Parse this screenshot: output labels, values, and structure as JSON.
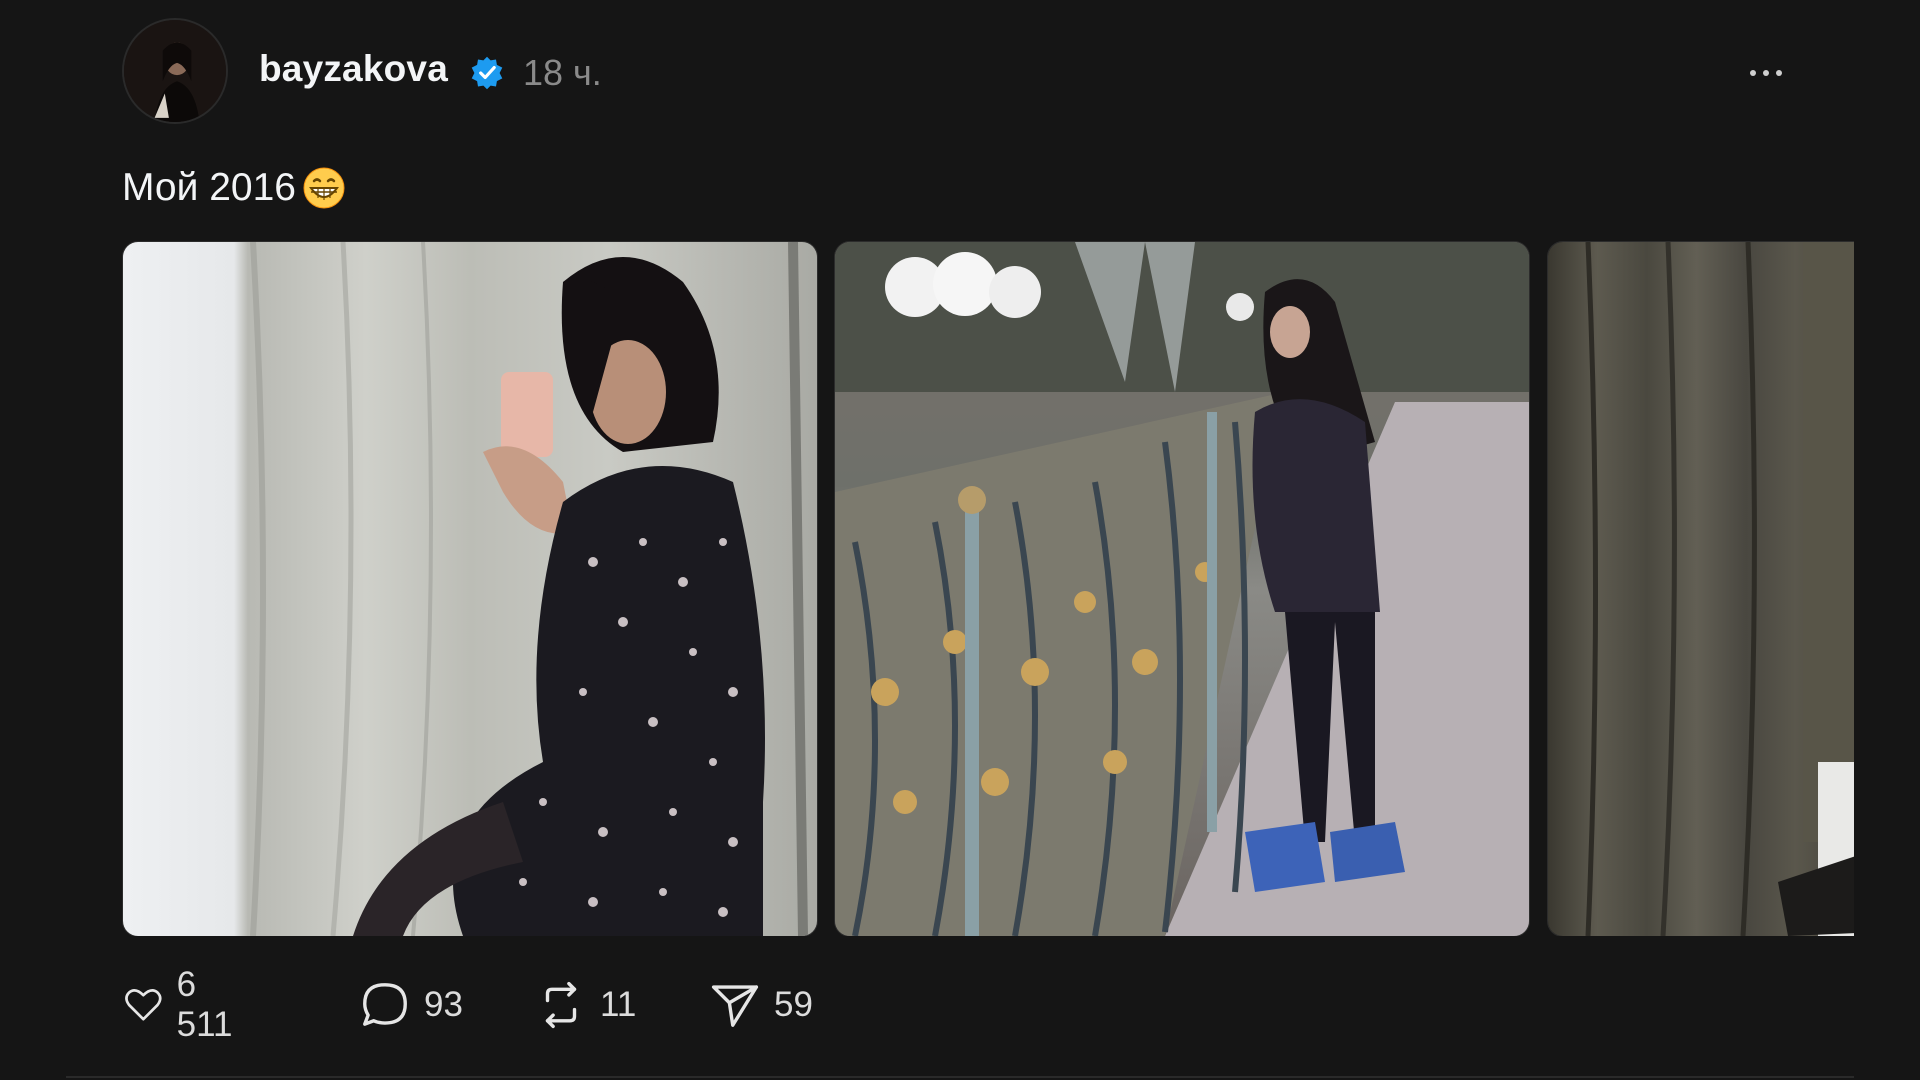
{
  "post": {
    "author": "bayzakova",
    "verified": true,
    "time": "18 ч.",
    "caption_text": "Мой 2016",
    "caption_emoji": "grinning-face-emoji",
    "more_icon": "more-horizontal-icon"
  },
  "media": [
    {
      "name": "mirror-selfie-photo",
      "description_icon": "image"
    },
    {
      "name": "fountain-park-photo",
      "description_icon": "image"
    },
    {
      "name": "curtain-photo",
      "description_icon": "image"
    }
  ],
  "actions": {
    "likes": "6 511",
    "comments": "93",
    "reposts": "11",
    "shares": "59"
  },
  "colors": {
    "background": "#151515",
    "verified_badge": "#1d9bf0",
    "muted_text": "#8a8a8a"
  }
}
